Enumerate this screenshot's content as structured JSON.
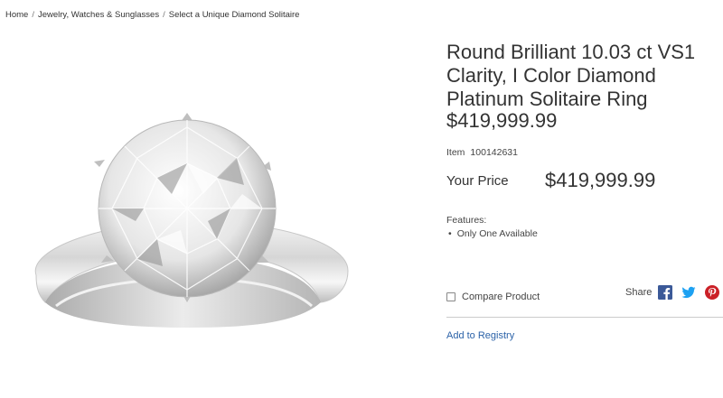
{
  "breadcrumb": {
    "items": [
      "Home",
      "Jewelry, Watches & Sunglasses",
      "Select a Unique Diamond Solitaire"
    ],
    "separator": "/"
  },
  "product": {
    "title": "Round Brilliant 10.03 ct VS1 Clarity, I Color Diamond Platinum Solitaire Ring",
    "title_price": "$419,999.99",
    "item_label": "Item",
    "item_number": "100142631",
    "price_label": "Your Price",
    "price_value": "$419,999.99",
    "features_label": "Features:",
    "features": [
      "Only One Available"
    ]
  },
  "actions": {
    "compare_label": "Compare Product",
    "share_label": "Share",
    "share_icons": [
      "facebook-icon",
      "twitter-icon",
      "pinterest-icon"
    ],
    "registry_label": "Add to Registry"
  },
  "colors": {
    "link": "#2b62a8",
    "facebook": "#3b5998",
    "twitter": "#1da1f2",
    "pinterest": "#cb2027"
  }
}
